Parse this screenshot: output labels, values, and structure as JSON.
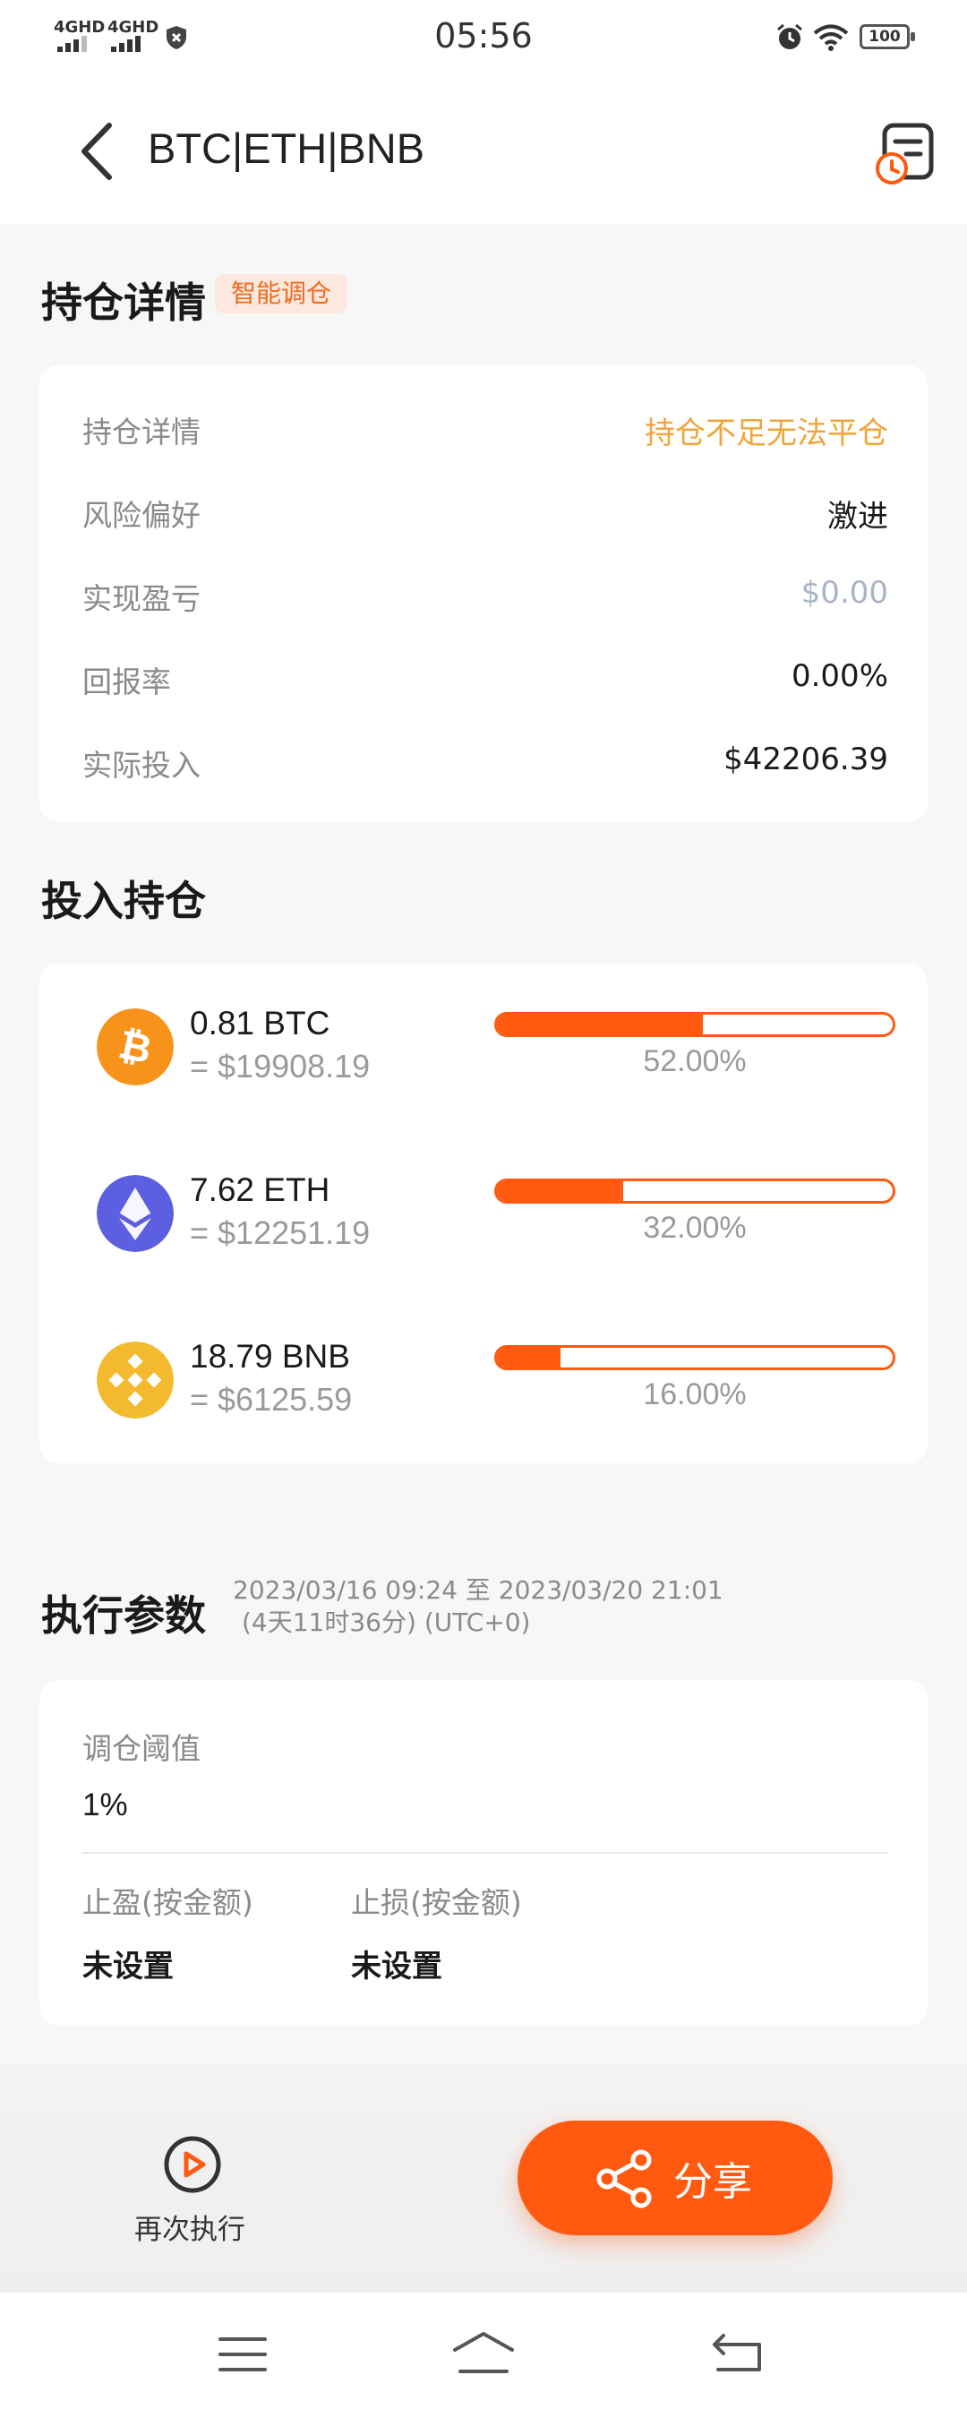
{
  "status": {
    "sig1": "4GHD",
    "sig2": "4GHD",
    "time": "05:56",
    "battery": "100"
  },
  "header": {
    "title": "BTC|ETH|BNB"
  },
  "holdings": {
    "title": "持仓详情",
    "tag": "智能调仓",
    "rows": [
      {
        "label": "持仓详情",
        "value": "持仓不足无法平仓",
        "color": "#f2a43a"
      },
      {
        "label": "风险偏好",
        "value": "激进",
        "color": "#1a1a1a"
      },
      {
        "label": "实现盈亏",
        "value": "$0.00",
        "color": "#a9b4c6"
      },
      {
        "label": "回报率",
        "value": "0.00%",
        "color": "#1a1a1a"
      },
      {
        "label": "实际投入",
        "value": "$42206.39",
        "color": "#1a1a1a"
      }
    ]
  },
  "positions": {
    "title": "投入持仓",
    "items": [
      {
        "icon": "bitcoin-icon",
        "amount": "0.81 BTC",
        "usd": "= $19908.19",
        "percent": "52.00%",
        "ratio": 0.52,
        "color": "#f7931a"
      },
      {
        "icon": "ethereum-icon",
        "amount": "7.62 ETH",
        "usd": "= $12251.19",
        "percent": "32.00%",
        "ratio": 0.32,
        "color": "#5b5fe0"
      },
      {
        "icon": "bnb-icon",
        "amount": "18.79 BNB",
        "usd": "= $6125.59",
        "percent": "16.00%",
        "ratio": 0.16,
        "color": "#f3ba2f"
      }
    ]
  },
  "params": {
    "title": "执行参数",
    "range_line1": "2023/03/16 09:24 至 2023/03/20 21:01",
    "range_line2": "(4天11时36分) (UTC+0)",
    "threshold_label": "调仓阈值",
    "threshold_value": "1%",
    "take_profit_label": "止盈(按金额)",
    "take_profit_value": "未设置",
    "stop_loss_label": "止损(按金额)",
    "stop_loss_value": "未设置"
  },
  "actions": {
    "redo_label": "再次执行",
    "share_label": "分享"
  },
  "colors": {
    "accent": "#ff5a10",
    "warning": "#f2a43a"
  }
}
